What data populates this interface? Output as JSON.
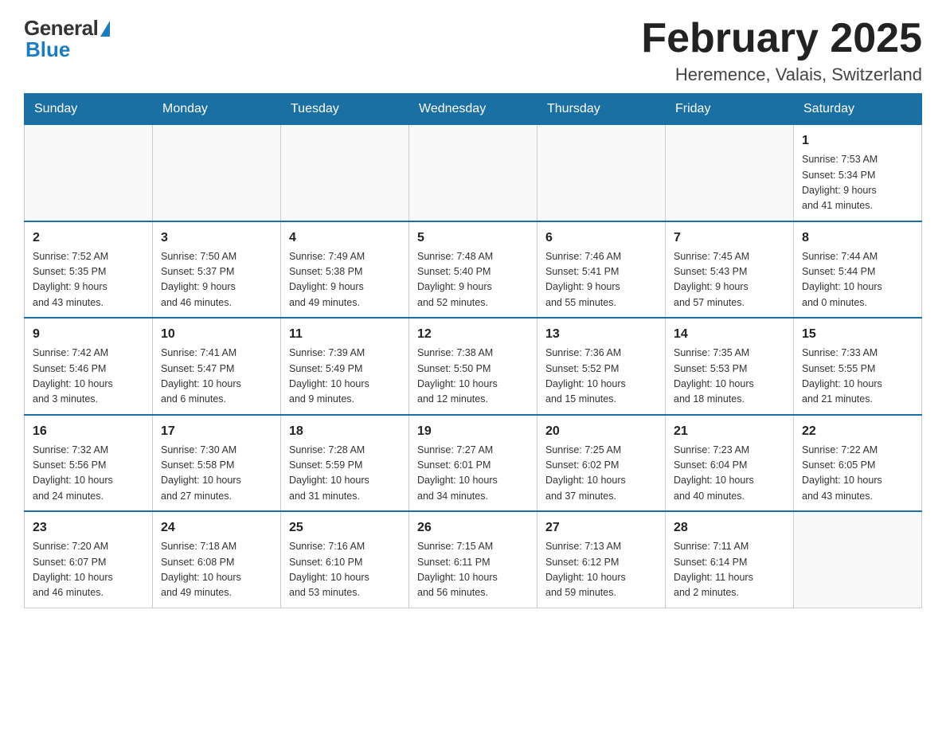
{
  "header": {
    "logo_general": "General",
    "logo_blue": "Blue",
    "month_title": "February 2025",
    "location": "Heremence, Valais, Switzerland"
  },
  "days_of_week": [
    "Sunday",
    "Monday",
    "Tuesday",
    "Wednesday",
    "Thursday",
    "Friday",
    "Saturday"
  ],
  "weeks": [
    [
      {
        "day": "",
        "info": ""
      },
      {
        "day": "",
        "info": ""
      },
      {
        "day": "",
        "info": ""
      },
      {
        "day": "",
        "info": ""
      },
      {
        "day": "",
        "info": ""
      },
      {
        "day": "",
        "info": ""
      },
      {
        "day": "1",
        "info": "Sunrise: 7:53 AM\nSunset: 5:34 PM\nDaylight: 9 hours\nand 41 minutes."
      }
    ],
    [
      {
        "day": "2",
        "info": "Sunrise: 7:52 AM\nSunset: 5:35 PM\nDaylight: 9 hours\nand 43 minutes."
      },
      {
        "day": "3",
        "info": "Sunrise: 7:50 AM\nSunset: 5:37 PM\nDaylight: 9 hours\nand 46 minutes."
      },
      {
        "day": "4",
        "info": "Sunrise: 7:49 AM\nSunset: 5:38 PM\nDaylight: 9 hours\nand 49 minutes."
      },
      {
        "day": "5",
        "info": "Sunrise: 7:48 AM\nSunset: 5:40 PM\nDaylight: 9 hours\nand 52 minutes."
      },
      {
        "day": "6",
        "info": "Sunrise: 7:46 AM\nSunset: 5:41 PM\nDaylight: 9 hours\nand 55 minutes."
      },
      {
        "day": "7",
        "info": "Sunrise: 7:45 AM\nSunset: 5:43 PM\nDaylight: 9 hours\nand 57 minutes."
      },
      {
        "day": "8",
        "info": "Sunrise: 7:44 AM\nSunset: 5:44 PM\nDaylight: 10 hours\nand 0 minutes."
      }
    ],
    [
      {
        "day": "9",
        "info": "Sunrise: 7:42 AM\nSunset: 5:46 PM\nDaylight: 10 hours\nand 3 minutes."
      },
      {
        "day": "10",
        "info": "Sunrise: 7:41 AM\nSunset: 5:47 PM\nDaylight: 10 hours\nand 6 minutes."
      },
      {
        "day": "11",
        "info": "Sunrise: 7:39 AM\nSunset: 5:49 PM\nDaylight: 10 hours\nand 9 minutes."
      },
      {
        "day": "12",
        "info": "Sunrise: 7:38 AM\nSunset: 5:50 PM\nDaylight: 10 hours\nand 12 minutes."
      },
      {
        "day": "13",
        "info": "Sunrise: 7:36 AM\nSunset: 5:52 PM\nDaylight: 10 hours\nand 15 minutes."
      },
      {
        "day": "14",
        "info": "Sunrise: 7:35 AM\nSunset: 5:53 PM\nDaylight: 10 hours\nand 18 minutes."
      },
      {
        "day": "15",
        "info": "Sunrise: 7:33 AM\nSunset: 5:55 PM\nDaylight: 10 hours\nand 21 minutes."
      }
    ],
    [
      {
        "day": "16",
        "info": "Sunrise: 7:32 AM\nSunset: 5:56 PM\nDaylight: 10 hours\nand 24 minutes."
      },
      {
        "day": "17",
        "info": "Sunrise: 7:30 AM\nSunset: 5:58 PM\nDaylight: 10 hours\nand 27 minutes."
      },
      {
        "day": "18",
        "info": "Sunrise: 7:28 AM\nSunset: 5:59 PM\nDaylight: 10 hours\nand 31 minutes."
      },
      {
        "day": "19",
        "info": "Sunrise: 7:27 AM\nSunset: 6:01 PM\nDaylight: 10 hours\nand 34 minutes."
      },
      {
        "day": "20",
        "info": "Sunrise: 7:25 AM\nSunset: 6:02 PM\nDaylight: 10 hours\nand 37 minutes."
      },
      {
        "day": "21",
        "info": "Sunrise: 7:23 AM\nSunset: 6:04 PM\nDaylight: 10 hours\nand 40 minutes."
      },
      {
        "day": "22",
        "info": "Sunrise: 7:22 AM\nSunset: 6:05 PM\nDaylight: 10 hours\nand 43 minutes."
      }
    ],
    [
      {
        "day": "23",
        "info": "Sunrise: 7:20 AM\nSunset: 6:07 PM\nDaylight: 10 hours\nand 46 minutes."
      },
      {
        "day": "24",
        "info": "Sunrise: 7:18 AM\nSunset: 6:08 PM\nDaylight: 10 hours\nand 49 minutes."
      },
      {
        "day": "25",
        "info": "Sunrise: 7:16 AM\nSunset: 6:10 PM\nDaylight: 10 hours\nand 53 minutes."
      },
      {
        "day": "26",
        "info": "Sunrise: 7:15 AM\nSunset: 6:11 PM\nDaylight: 10 hours\nand 56 minutes."
      },
      {
        "day": "27",
        "info": "Sunrise: 7:13 AM\nSunset: 6:12 PM\nDaylight: 10 hours\nand 59 minutes."
      },
      {
        "day": "28",
        "info": "Sunrise: 7:11 AM\nSunset: 6:14 PM\nDaylight: 11 hours\nand 2 minutes."
      },
      {
        "day": "",
        "info": ""
      }
    ]
  ]
}
